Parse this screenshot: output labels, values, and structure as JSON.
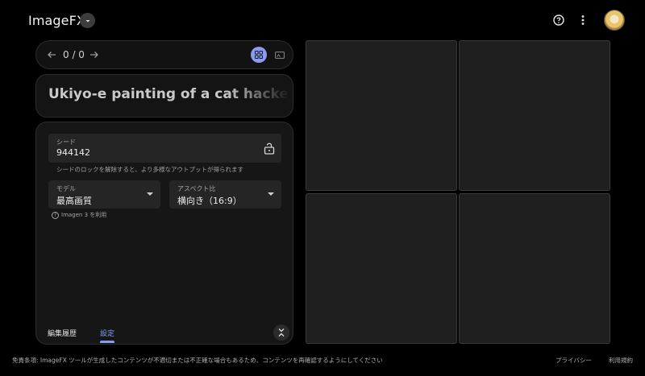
{
  "header": {
    "app_title": "ImageFX",
    "icons": {
      "dropdown": "chevron-down-icon",
      "help": "help-circle-icon",
      "more": "more-vert-icon"
    }
  },
  "navigation": {
    "count": "0 / 0",
    "icons": {
      "prev": "arrow-left-icon",
      "next": "arrow-right-icon",
      "grid": "grid-view-icon",
      "single": "single-view-icon"
    }
  },
  "prompt": {
    "text": "Ukiyo-e painting of a cat hacker wearing"
  },
  "settings": {
    "seed": {
      "label": "シード",
      "value": "944142",
      "icon": "lock-open-icon"
    },
    "seed_hint": "シードのロックを解除すると、より多様なアウトプットが得られます",
    "model": {
      "label": "モデル",
      "value": "最高画質"
    },
    "aspect": {
      "label": "アスペクト比",
      "value": "横向き（16:9）"
    },
    "imagen_info": "Imagen 3 を利用"
  },
  "tabs": {
    "history": "編集履歴",
    "settings": "設定",
    "active": "settings"
  },
  "images": {
    "count": 4
  },
  "footer": {
    "disclaimer": "免責条項: ImageFX ツールが生成したコンテンツが不適切または不正確な場合もあるため、コンテンツを再確認するようにしてください",
    "privacy": "プライバシー",
    "terms": "利用規約"
  },
  "colors": {
    "accent": "#8a9bf2",
    "background": "#000000",
    "panel": "#161616",
    "field": "#252525",
    "tile": "#1f1f1f"
  }
}
